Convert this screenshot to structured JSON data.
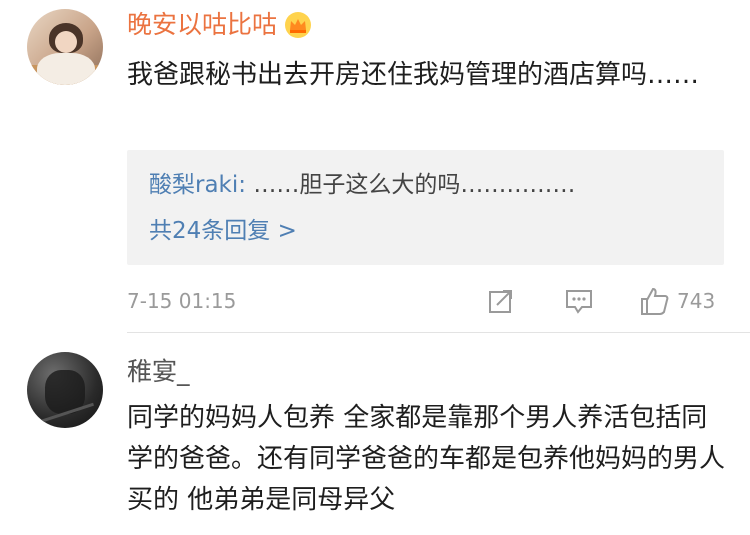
{
  "comments": [
    {
      "username": "晚安以咕比咕",
      "username_color": "#eb7340",
      "badge_icon": "crown-vip-icon",
      "text": "我爸跟秘书出去开房还住我妈管理的酒店算吗……",
      "reply_preview": {
        "user": "酸梨raki:",
        "text": " ……胆子这么大的吗……………",
        "more_label": "共24条回复 >"
      },
      "timestamp": "7-15 01:15",
      "actions": {
        "share_icon": "share-icon",
        "comment_icon": "comment-icon",
        "like_icon": "thumbs-up-icon",
        "like_count": "743"
      }
    },
    {
      "username": "稚宴_",
      "username_color": "#555555",
      "text": "同学的妈妈人包养 全家都是靠那个男人养活包括同学的爸爸。还有同学爸爸的车都是包养他妈妈的男人买的 他弟弟是同母异父"
    }
  ],
  "colors": {
    "link": "#4f7fb3",
    "meta": "#9a9a9a",
    "reply_bg": "#f2f2f2"
  }
}
